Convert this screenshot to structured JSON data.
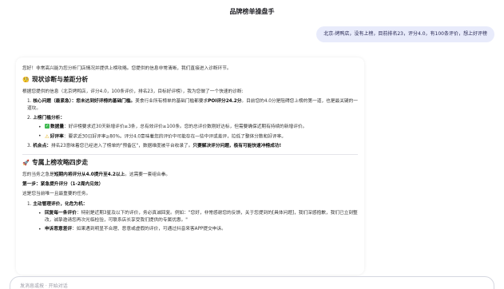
{
  "header": {
    "title": "品牌榜单操盘手"
  },
  "user_message": "北京-烤鸭店，没有上榜，目前排名23，评分4.0，有100条评价，想上好评榜",
  "answer": {
    "intro": "您好！非常高兴能为您分析门店情况并提供上榜攻略。您提供的信息非常清晰，我们直接进入诊断环节。",
    "section1": {
      "icon": "🧐",
      "title": "现状诊断与差距分析",
      "lead": "根据您提供的信息（北京烤鸭店，评分4.0，100条评价，排名23，目标好评榜），我为您做了一个快速的诊断:",
      "item1": {
        "prefix": "1. ",
        "label": "核心问题（最紧急）",
        "sep": "：",
        "bold_text": "您未达到好评榜的基础门槛。",
        "text_a": "美食行业所有榜单的基础门槛都要求",
        "bold_text2": "POI评分24.2分",
        "text_b": "。目前您的4.0分是阻碍您上榜的第一道，也是最关键的一道坎。"
      },
      "item2": {
        "prefix": "2. ",
        "label": "上榜门槛分析",
        "sep": "：",
        "sub1": {
          "label": "数据量",
          "text": "：好评榜要求近30天新增评价≥3条，总有效评价≥100条。您的总评价数刚好达标，但需要确保近期有持续的新增评价。"
        },
        "sub2": {
          "label": "好评率",
          "text": "：要求近30日好评率≥80%。评分4.0意味着您的评价中可能存在一些中评或差评，拉低了整体分数和好评率。"
        }
      },
      "item3": {
        "prefix": "3. ",
        "label": "机会点",
        "sep": "：",
        "text": "排名23意味着您已经进入了榜单的\"预备区\"，数据维度被平台收录了。",
        "bold_text": "只要解决评分问题，极有可能快速冲榜成功!"
      }
    },
    "section2": {
      "icon": "🚀",
      "title": "专属上榜攻略四步走",
      "goal_a": "您的当务之急是",
      "goal_bold": "短期内将评分从4.0提升至4.2以上",
      "goal_b": "。这需要一套组合拳。",
      "step1": "第一步：紧急提升评分（1-2周内见效）",
      "step1_note": "这是您当前唯一且最重要的任务。",
      "item1": {
        "prefix": "1. ",
        "label": "主动管理评价，化危为机",
        "sep": "：",
        "b1": {
          "label": "回复每一条评价",
          "text": "：特别是近期3星及以下的评价，务必真诚回复。例如：\"您好，非常感谢您的反馈，关于您提到的[具体问题]，我们深感抱歉，我们已立刻整改，诚挚邀请您再次光临检验，可联系店长享受我们提供的专属优惠。\""
        },
        "b2": {
          "label": "申诉恶意差评",
          "text": "：如果遇到明显不合理、恶意或虚假的评价，可通过抖音来客APP提交申诉。"
        }
      }
    }
  },
  "input": {
    "placeholder": "发消息或按 · 开始对话"
  }
}
